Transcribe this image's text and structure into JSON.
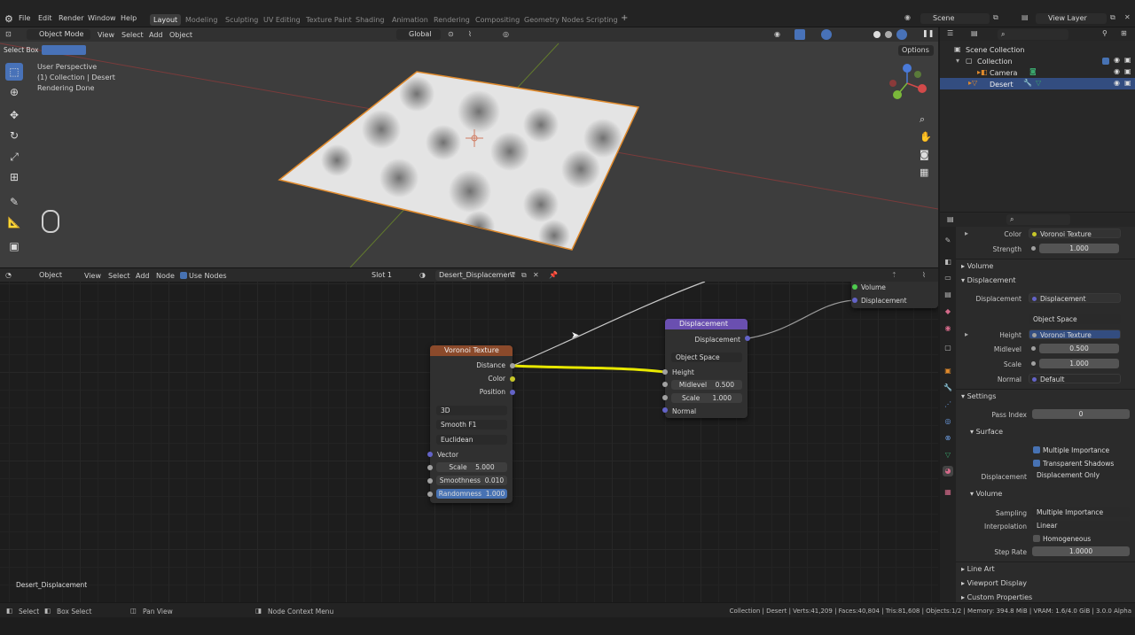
{
  "topbar": {
    "menus": [
      "File",
      "Edit",
      "Render",
      "Window",
      "Help"
    ],
    "workspaces": [
      "Layout",
      "Modeling",
      "Sculpting",
      "UV Editing",
      "Texture Paint",
      "Shading",
      "Animation",
      "Rendering",
      "Compositing",
      "Geometry Nodes",
      "Scripting"
    ],
    "active_workspace": "Layout",
    "scene": "Scene",
    "view_layer": "View Layer"
  },
  "viewport": {
    "tool_label": "Select Box",
    "mode": "Object Mode",
    "menus": [
      "View",
      "Select",
      "Add",
      "Object"
    ],
    "orientation": "Global",
    "options": "Options",
    "info": [
      "User Perspective",
      "(1) Collection | Desert",
      "Rendering Done"
    ]
  },
  "node_editor": {
    "type": "Object",
    "menus": [
      "View",
      "Select",
      "Add",
      "Node"
    ],
    "use_nodes": "Use Nodes",
    "slot": "Slot 1",
    "material": "Desert_Displacement",
    "footer_material": "Desert_Displacement",
    "voronoi": {
      "title": "Voronoi Texture",
      "outputs": [
        "Distance",
        "Color",
        "Position"
      ],
      "dims": "3D",
      "feature": "Smooth F1",
      "metric": "Euclidean",
      "vector": "Vector",
      "scale_label": "Scale",
      "scale": "5.000",
      "smooth_label": "Smoothness",
      "smooth": "0.010",
      "rand_label": "Randomness",
      "rand": "1.000"
    },
    "displacement": {
      "title": "Displacement",
      "output": "Displacement",
      "space": "Object Space",
      "height": "Height",
      "mid_label": "Midlevel",
      "mid": "0.500",
      "scale_label": "Scale",
      "scale": "1.000",
      "normal": "Normal"
    },
    "output_partial": {
      "volume": "Volume",
      "displacement": "Displacement"
    }
  },
  "outliner": {
    "root": "Scene Collection",
    "collection": "Collection",
    "items": [
      "Camera",
      "Desert"
    ]
  },
  "properties": {
    "color_label": "Color",
    "color_value": "Voronoi Texture",
    "strength_label": "Strength",
    "strength": "1.000",
    "sec_volume": "Volume",
    "sec_displacement": "Displacement",
    "disp_label": "Displacement",
    "disp_value": "Displacement",
    "space": "Object Space",
    "height_label": "Height",
    "height_value": "Voronoi Texture",
    "mid_label": "Midlevel",
    "mid": "0.500",
    "scale_label": "Scale",
    "scale": "1.000",
    "normal_label": "Normal",
    "normal_value": "Default",
    "sec_settings": "Settings",
    "pass_label": "Pass Index",
    "pass": "0",
    "sec_surface": "Surface",
    "multi_imp": "Multiple Importance",
    "transp": "Transparent Shadows",
    "disp2_label": "Displacement",
    "disp2_value": "Displacement Only",
    "sec_volume2": "Volume",
    "sampling_label": "Sampling",
    "sampling": "Multiple Importance",
    "interp_label": "Interpolation",
    "interp": "Linear",
    "homog": "Homogeneous",
    "step_label": "Step Rate",
    "step": "1.0000",
    "sec_lineart": "Line Art",
    "sec_viewport": "Viewport Display",
    "sec_custom": "Custom Properties"
  },
  "statusbar": {
    "select": "Select",
    "box_select": "Box Select",
    "pan": "Pan View",
    "context": "Node Context Menu",
    "stats": "Collection | Desert | Verts:41,209 | Faces:40,804 | Tris:81,608 | Objects:1/2 | Memory: 394.8 MiB | VRAM: 1.6/4.0 GiB | 3.0.0 Alpha"
  }
}
